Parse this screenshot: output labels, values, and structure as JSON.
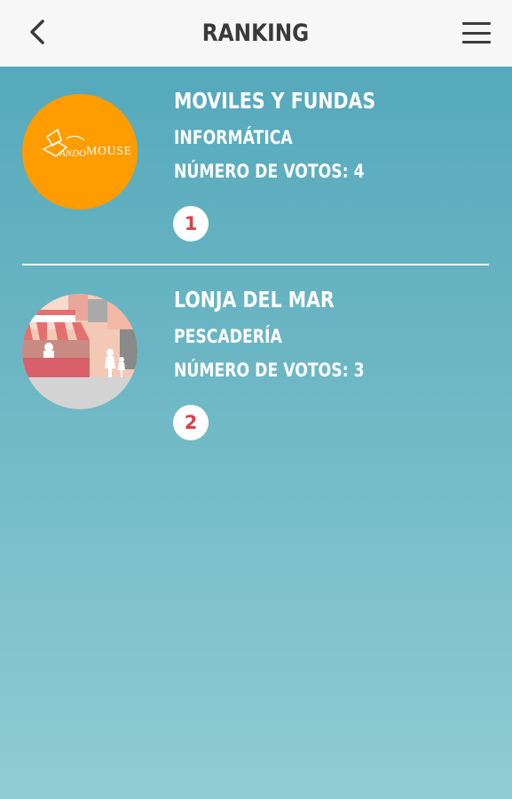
{
  "header": {
    "title": "RANKING",
    "back_icon": "chevron-left-icon",
    "menu_icon": "hamburger-menu-icon"
  },
  "ranking": [
    {
      "name": "MOVILES Y FUNDAS",
      "category": "INFORMÁTICA",
      "votes_text": "NÚMERO DE VOTOS: 4",
      "rank": "1",
      "logo_text": "MOUSE",
      "logo_color": "#ff9c00"
    },
    {
      "name": "LONJA DEL MAR",
      "category": "PESCADERÍA",
      "votes_text": "NÚMERO DE VOTOS: 3",
      "rank": "2"
    }
  ],
  "colors": {
    "header_bg": "#f7f7f7",
    "bg_top": "#50a6ba",
    "bg_bottom": "#8fcdd3",
    "rank_text": "#d8424a"
  }
}
